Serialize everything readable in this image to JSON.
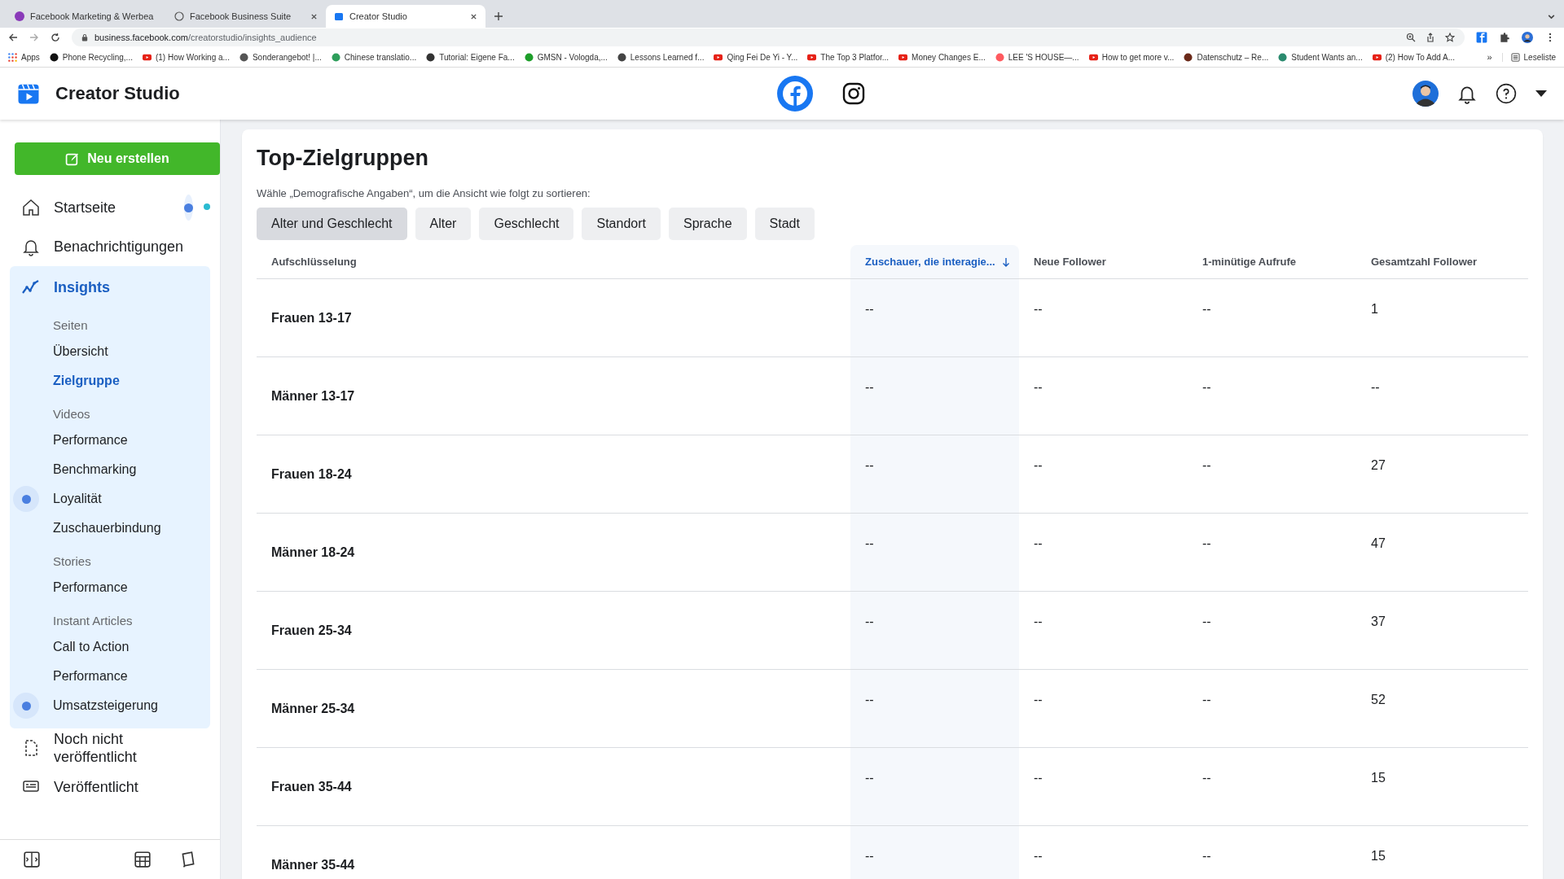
{
  "browser": {
    "tabs": [
      {
        "title": "Facebook Marketing & Werbea",
        "selected": false
      },
      {
        "title": "Facebook Business Suite",
        "selected": false
      },
      {
        "title": "Creator Studio",
        "selected": true
      }
    ],
    "url_host": "business.facebook.com",
    "url_path": "/creatorstudio/insights_audience",
    "bookmarks": [
      {
        "label": "Apps",
        "kind": "apps"
      },
      {
        "label": "Phone Recycling,...",
        "kind": "badge",
        "color": "#111111"
      },
      {
        "label": "(1) How Working a...",
        "kind": "youtube"
      },
      {
        "label": "Sonderangebot! |...",
        "kind": "badge",
        "color": "#555555"
      },
      {
        "label": "Chinese translatio...",
        "kind": "badge",
        "color": "#2e9e5b"
      },
      {
        "label": "Tutorial: Eigene Fa...",
        "kind": "badge",
        "color": "#333333"
      },
      {
        "label": "GMSN - Vologda,...",
        "kind": "badge",
        "color": "#1e9e2a"
      },
      {
        "label": "Lessons Learned f...",
        "kind": "badge",
        "color": "#444444"
      },
      {
        "label": "Qing Fei De Yi - Y...",
        "kind": "youtube"
      },
      {
        "label": "The Top 3 Platfor...",
        "kind": "youtube"
      },
      {
        "label": "Money Changes E...",
        "kind": "youtube"
      },
      {
        "label": "LEE 'S HOUSE—...",
        "kind": "badge",
        "color": "#ff5a5f"
      },
      {
        "label": "How to get more v...",
        "kind": "youtube"
      },
      {
        "label": "Datenschutz – Re...",
        "kind": "badge",
        "color": "#6b2a1a"
      },
      {
        "label": "Student Wants an...",
        "kind": "badge",
        "color": "#2a8a6e"
      },
      {
        "label": "(2) How To Add A...",
        "kind": "youtube"
      }
    ],
    "more": "»",
    "reading_list": "Leseliste"
  },
  "app": {
    "title": "Creator Studio"
  },
  "platforms": [
    {
      "kind": "facebook",
      "selected": true
    },
    {
      "kind": "instagram",
      "selected": false
    }
  ],
  "sidebar": {
    "create_button": "Neu erstellen",
    "items": [
      {
        "label": "Startseite",
        "selected": false,
        "dot": true
      },
      {
        "label": "Benachrichtigungen",
        "selected": false,
        "dot": false
      },
      {
        "label": "Insights",
        "selected": true,
        "dot": false,
        "sections": [
          {
            "heading": "Seiten",
            "items": [
              {
                "label": "Übersicht",
                "selected": false,
                "dot": false
              },
              {
                "label": "Zielgruppe",
                "selected": true,
                "dot": false
              }
            ]
          },
          {
            "heading": "Videos",
            "items": [
              {
                "label": "Performance",
                "selected": false,
                "dot": false
              },
              {
                "label": "Benchmarking",
                "selected": false,
                "dot": false
              },
              {
                "label": "Loyalität",
                "selected": false,
                "dot": true
              },
              {
                "label": "Zuschauerbindung",
                "selected": false,
                "dot": false
              }
            ]
          },
          {
            "heading": "Stories",
            "items": [
              {
                "label": "Performance",
                "selected": false,
                "dot": false
              }
            ]
          },
          {
            "heading": "Instant Articles",
            "items": [
              {
                "label": "Call to Action",
                "selected": false,
                "dot": false
              },
              {
                "label": "Performance",
                "selected": false,
                "dot": false
              },
              {
                "label": "Umsatzsteigerung",
                "selected": false,
                "dot": true
              }
            ]
          }
        ]
      },
      {
        "label": "Noch nicht veröffentlicht",
        "selected": false,
        "dot": false
      },
      {
        "label": "Veröffentlicht",
        "selected": false,
        "dot": false
      }
    ]
  },
  "card": {
    "title": "Top-Zielgruppen",
    "subtitle": "Wähle „Demografische Angaben“, um die Ansicht wie folgt zu sortieren:",
    "filters": [
      {
        "label": "Alter und Geschlecht",
        "selected": true
      },
      {
        "label": "Alter",
        "selected": false
      },
      {
        "label": "Geschlecht",
        "selected": false
      },
      {
        "label": "Standort",
        "selected": false
      },
      {
        "label": "Sprache",
        "selected": false
      },
      {
        "label": "Stadt",
        "selected": false
      }
    ],
    "table": {
      "columns": [
        {
          "label": "Aufschlüsselung",
          "sorted": false
        },
        {
          "label": "Zuschauer, die interagie...",
          "sorted": true
        },
        {
          "label": "Neue Follower",
          "sorted": false
        },
        {
          "label": "1-minütige Aufrufe",
          "sorted": false
        },
        {
          "label": "Gesamtzahl Follower",
          "sorted": false
        }
      ],
      "rows": [
        {
          "name": "Frauen 13-17",
          "values": [
            "--",
            "--",
            "--",
            "1"
          ]
        },
        {
          "name": "Männer 13-17",
          "values": [
            "--",
            "--",
            "--",
            "--"
          ]
        },
        {
          "name": "Frauen 18-24",
          "values": [
            "--",
            "--",
            "--",
            "27"
          ]
        },
        {
          "name": "Männer 18-24",
          "values": [
            "--",
            "--",
            "--",
            "47"
          ]
        },
        {
          "name": "Frauen 25-34",
          "values": [
            "--",
            "--",
            "--",
            "37"
          ]
        },
        {
          "name": "Männer 25-34",
          "values": [
            "--",
            "--",
            "--",
            "52"
          ]
        },
        {
          "name": "Frauen 35-44",
          "values": [
            "--",
            "--",
            "--",
            "15"
          ]
        },
        {
          "name": "Männer 35-44",
          "values": [
            "--",
            "--",
            "--",
            "15"
          ]
        }
      ]
    }
  }
}
